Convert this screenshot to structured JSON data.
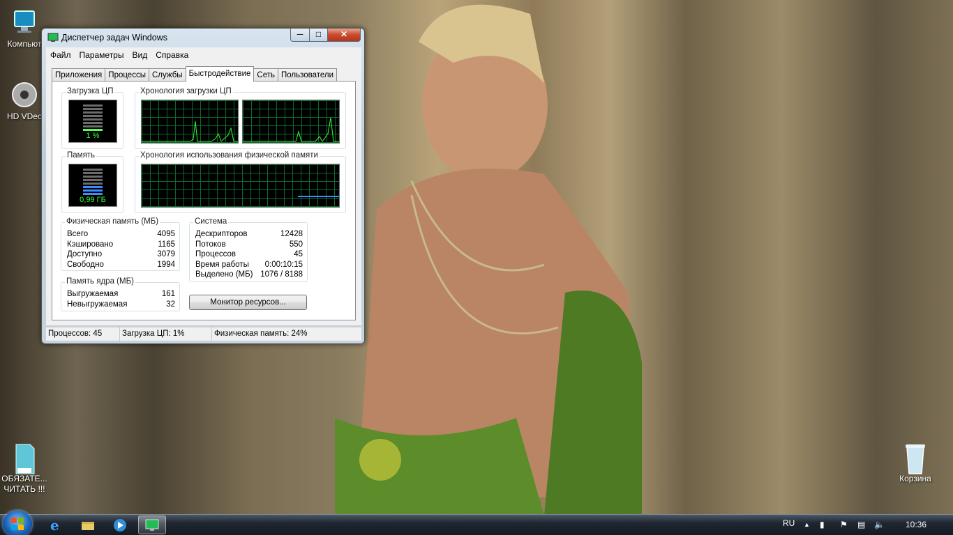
{
  "desktop": {
    "icons": [
      {
        "label": "Компьют"
      },
      {
        "label": "HD VDec"
      },
      {
        "label_line1": "ОБЯЗАТЕ...",
        "label_line2": "ЧИТАТЬ !!!",
        "badge": "TEXT"
      },
      {
        "label": "Корзина"
      }
    ]
  },
  "window": {
    "title": "Диспетчер задач Windows",
    "controls": {
      "minimize": "minimize-icon",
      "maximize": "maximize-icon",
      "close": "close-icon"
    },
    "menu": [
      "Файл",
      "Параметры",
      "Вид",
      "Справка"
    ],
    "tabs": [
      "Приложения",
      "Процессы",
      "Службы",
      "Быстродействие",
      "Сеть",
      "Пользователи"
    ],
    "active_tab": "Быстродействие",
    "cpu_usage": {
      "label": "Загрузка ЦП",
      "value": "1 %"
    },
    "cpu_history": {
      "label": "Хронология загрузки ЦП"
    },
    "memory": {
      "label": "Память",
      "value": "0,99 ГБ"
    },
    "memory_history": {
      "label": "Хронология использования физической памяти"
    },
    "physical_memory": {
      "label": "Физическая память (МБ)",
      "rows": [
        {
          "key": "Всего",
          "value": "4095"
        },
        {
          "key": "Кэшировано",
          "value": "1165"
        },
        {
          "key": "Доступно",
          "value": "3079"
        },
        {
          "key": "Свободно",
          "value": "1994"
        }
      ]
    },
    "kernel_memory": {
      "label": "Память ядра (МБ)",
      "rows": [
        {
          "key": "Выгружаемая",
          "value": "161"
        },
        {
          "key": "Невыгружаемая",
          "value": "32"
        }
      ]
    },
    "system": {
      "label": "Система",
      "rows": [
        {
          "key": "Дескрипторов",
          "value": "12428"
        },
        {
          "key": "Потоков",
          "value": "550"
        },
        {
          "key": "Процессов",
          "value": "45"
        },
        {
          "key": "Время работы",
          "value": "0:00:10:15"
        },
        {
          "key": "Выделено (МБ)",
          "value": "1076 / 8188"
        }
      ]
    },
    "resource_monitor_button": "Монитор ресурсов...",
    "status": {
      "processes": "Процессов: 45",
      "cpu": "Загрузка ЦП: 1%",
      "memory": "Физическая память: 24%"
    }
  },
  "taskbar": {
    "pinned": [
      "start-icon",
      "ie-icon",
      "explorer-icon",
      "media-player-icon",
      "task-manager-icon"
    ],
    "lang": "RU",
    "clock": "10:36"
  },
  "colors": {
    "graph_grid": "#0b6b2e",
    "graph_line": "#33ff33",
    "memory_line": "#3a8dff"
  }
}
